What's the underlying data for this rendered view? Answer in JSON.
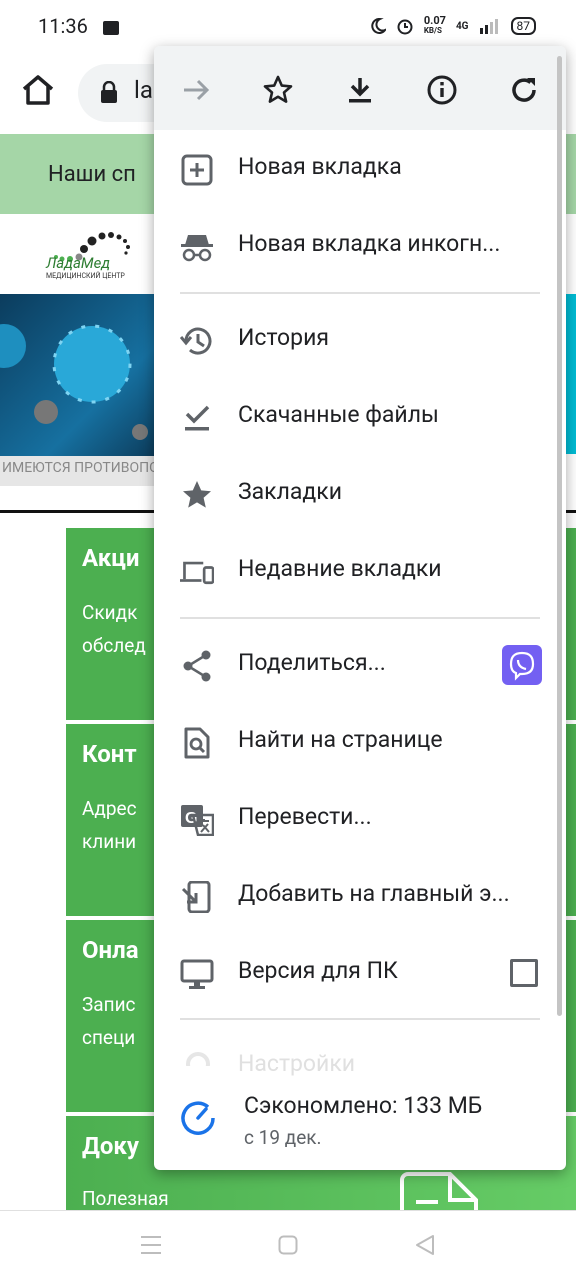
{
  "status_bar": {
    "time": "11:36",
    "net_speed": "0.07",
    "net_unit": "KB/S",
    "network": "4G",
    "battery": "87"
  },
  "browser": {
    "url_text": "la"
  },
  "page": {
    "banner_text": "Наши сп",
    "logo_name": "ЛадаМед",
    "logo_sub": "МЕДИЦИНСКИЙ ЦЕНТР",
    "hero_caption": "ИМЕЮТСЯ ПРОТИВОПОКА",
    "cards": [
      {
        "title": "Акци",
        "text": [
          "Скидк",
          "обслед"
        ]
      },
      {
        "title": "Конт",
        "text": [
          "Адрес",
          "клини"
        ]
      },
      {
        "title": "Онла",
        "text": [
          "Запис",
          "специ"
        ]
      },
      {
        "title": "Доку",
        "text": [
          "Полезная"
        ]
      }
    ]
  },
  "menu": {
    "items": [
      {
        "label": "Новая вкладка",
        "icon": "new-tab-icon"
      },
      {
        "label": "Новая вкладка инкогн...",
        "icon": "incognito-icon"
      },
      {
        "label": "История",
        "icon": "history-icon"
      },
      {
        "label": "Скачанные файлы",
        "icon": "downloads-icon"
      },
      {
        "label": "Закладки",
        "icon": "bookmarks-star-icon"
      },
      {
        "label": "Недавние вкладки",
        "icon": "recent-tabs-icon"
      },
      {
        "label": "Поделиться...",
        "icon": "share-icon"
      },
      {
        "label": "Найти на странице",
        "icon": "find-in-page-icon"
      },
      {
        "label": "Перевести...",
        "icon": "translate-icon"
      },
      {
        "label": "Добавить на главный э...",
        "icon": "add-to-home-icon"
      },
      {
        "label": "Версия для ПК",
        "icon": "desktop-icon"
      }
    ],
    "settings_ghost": "Настройки",
    "savings_title": "Сэкономлено: 133 МБ",
    "savings_subtitle": "с 19 дек."
  },
  "colors": {
    "menu_icon": "#5f6368",
    "page_green": "#4caf50",
    "banner_green": "#a5d6a7",
    "viber": "#7360f2",
    "savings_blue": "#1a73e8"
  }
}
